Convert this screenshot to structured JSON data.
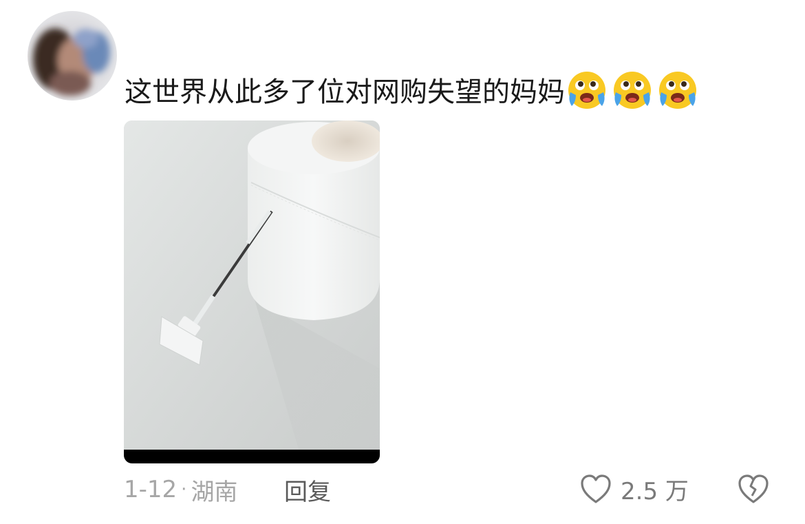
{
  "comment": {
    "text": "这世界从此多了位对网购失望的妈妈",
    "emojis": [
      "crying-face-icon",
      "crying-face-icon",
      "crying-face-icon"
    ]
  },
  "meta": {
    "date": "1-12",
    "separator": "·",
    "location": "湖南",
    "reply_label": "回复",
    "likes": "2.5 万"
  },
  "colors": {
    "text": "#1a1a1a",
    "meta": "#a6a6a6",
    "reply": "#5a5a5a",
    "emoji_yellow": "#f9c923",
    "tears": "#4aa3e8"
  }
}
